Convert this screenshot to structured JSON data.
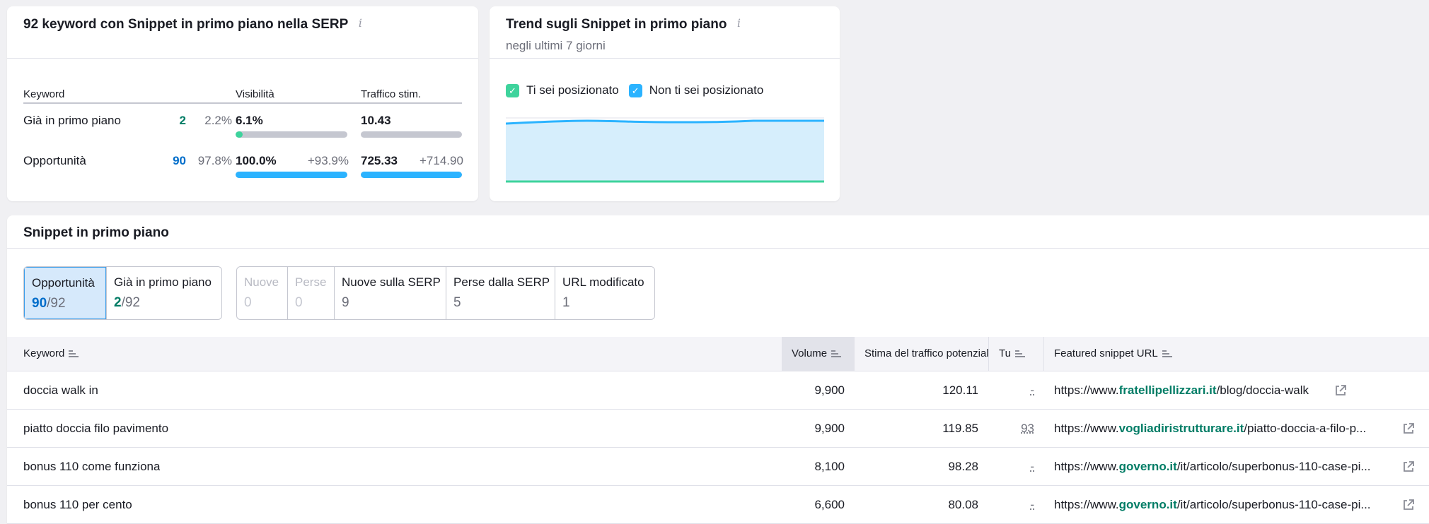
{
  "summary": {
    "title": "92 keyword con Snippet in primo piano nella SERP",
    "headers": {
      "keyword": "Keyword",
      "visibility": "Visibilità",
      "traffic": "Traffico stim."
    },
    "rows": [
      {
        "label": "Già in primo piano",
        "count": "2",
        "percent": "2.2%",
        "visibility": "6.1%",
        "visibility_delta": "",
        "traffic": "10.43",
        "traffic_delta": "",
        "visibility_level": 0.061,
        "traffic_level": 0.0,
        "count_color": "#007c65",
        "fill_color": "#3ed39c"
      },
      {
        "label": "Opportunità",
        "count": "90",
        "percent": "97.8%",
        "visibility": "100.0%",
        "visibility_delta": "+93.9%",
        "traffic": "725.33",
        "traffic_delta": "+714.90",
        "visibility_level": 1.0,
        "traffic_level": 1.0,
        "count_color": "#006dca",
        "fill_color": "#2bb3ff"
      }
    ]
  },
  "trend": {
    "title": "Trend sugli Snippet in primo piano",
    "subtitle": "negli ultimi 7 giorni",
    "legend": [
      {
        "label": "Ti sei posizionato",
        "color": "#3ed39c"
      },
      {
        "label": "Non ti sei posizionato",
        "color": "#2bb3ff"
      }
    ]
  },
  "snippets": {
    "title": "Snippet in primo piano",
    "tabs_primary": [
      {
        "label": "Opportunità",
        "value_strong": "90",
        "value_rest": "/92",
        "active": true,
        "color": "blue"
      },
      {
        "label": "Già in primo piano",
        "value_strong": "2",
        "value_rest": "/92",
        "active": false,
        "color": "green"
      }
    ],
    "tabs_secondary": [
      {
        "label": "Nuove",
        "value": "0",
        "disabled": true
      },
      {
        "label": "Perse",
        "value": "0",
        "disabled": true
      },
      {
        "label": "Nuove sulla SERP",
        "value": "9",
        "disabled": false
      },
      {
        "label": "Perse dalla SERP",
        "value": "5",
        "disabled": false
      },
      {
        "label": "URL modificato",
        "value": "1",
        "disabled": false
      }
    ],
    "columns": {
      "keyword": "Keyword",
      "volume": "Volume",
      "traffic": "Stima del traffico potenziale",
      "you": "Tu",
      "url": "Featured snippet URL"
    },
    "rows": [
      {
        "keyword": "doccia walk in",
        "volume": "9,900",
        "traffic": "120.11",
        "you": "-",
        "url_prefix": "https://www.",
        "url_domain": "fratellipellizzari.it",
        "url_path": "/blog/doccia-walk"
      },
      {
        "keyword": "piatto doccia filo pavimento",
        "volume": "9,900",
        "traffic": "119.85",
        "you": "93",
        "url_prefix": "https://www.",
        "url_domain": "vogliadiristrutturare.it",
        "url_path": "/piatto-doccia-a-filo-p..."
      },
      {
        "keyword": "bonus 110 come funziona",
        "volume": "8,100",
        "traffic": "98.28",
        "you": "-",
        "url_prefix": "https://www.",
        "url_domain": "governo.it",
        "url_path": "/it/articolo/superbonus-110-case-pi..."
      },
      {
        "keyword": "bonus 110 per cento",
        "volume": "6,600",
        "traffic": "80.08",
        "you": "-",
        "url_prefix": "https://www.",
        "url_domain": "governo.it",
        "url_path": "/it/articolo/superbonus-110-case-pi..."
      }
    ]
  }
}
